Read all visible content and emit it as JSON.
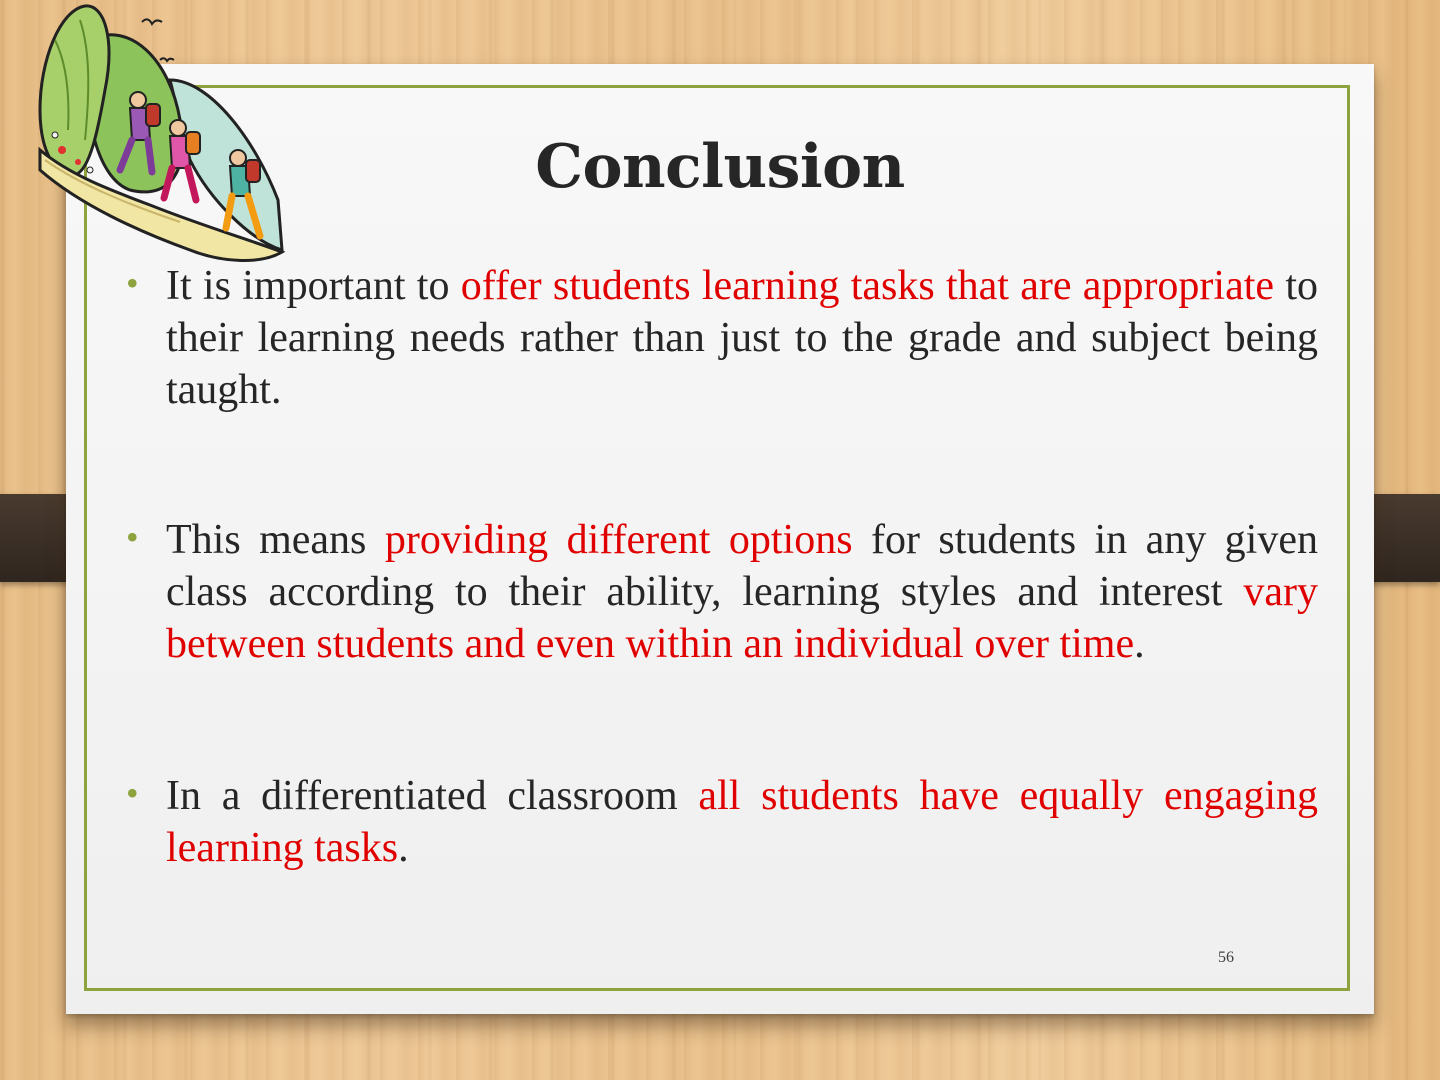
{
  "slide": {
    "title": "Conclusion",
    "slide_number": "56",
    "clipart_icon": "hikers-on-mountain-path-icon",
    "colors": {
      "frame": "#8ea33e",
      "bullet": "#8ea33e",
      "highlight": "#e00000",
      "text": "#262626"
    },
    "bullets": [
      {
        "segments": [
          {
            "text": "It is important to ",
            "highlight": false
          },
          {
            "text": "offer students learning tasks that are appropriate",
            "highlight": true
          },
          {
            "text": " to their learning needs rather than just to the grade and subject being taught.",
            "highlight": false
          }
        ]
      },
      {
        "segments": [
          {
            "text": "This means ",
            "highlight": false
          },
          {
            "text": "providing different options",
            "highlight": true
          },
          {
            "text": " for students in any given class according to their ability, learning styles and interest ",
            "highlight": false
          },
          {
            "text": "vary between students and even within an individual over time",
            "highlight": true
          },
          {
            "text": ".",
            "highlight": false
          }
        ]
      },
      {
        "segments": [
          {
            "text": "In a differentiated classroom ",
            "highlight": false
          },
          {
            "text": "all students have equally engaging learning tasks",
            "highlight": true
          },
          {
            "text": ".",
            "highlight": false
          }
        ]
      }
    ]
  }
}
